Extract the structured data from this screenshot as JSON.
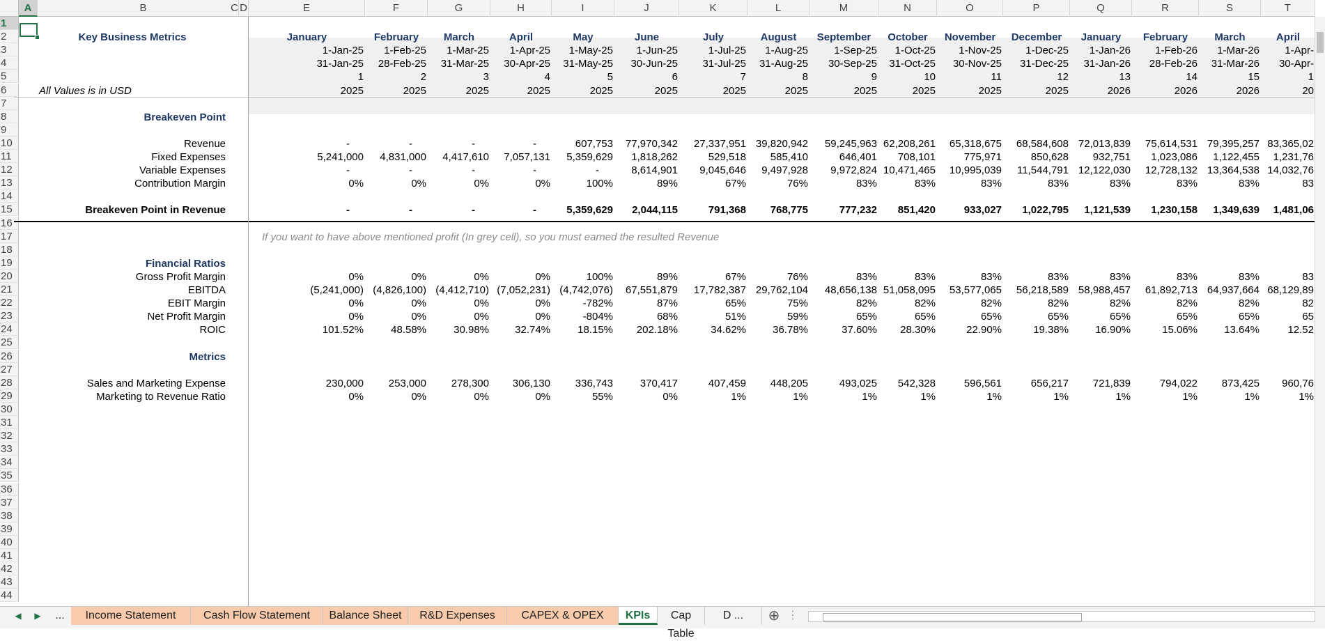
{
  "columns": [
    "A",
    "B",
    "C",
    "D",
    "E",
    "F",
    "G",
    "H",
    "I",
    "J",
    "K",
    "L",
    "M",
    "N",
    "O",
    "P",
    "Q",
    "R",
    "S",
    "T"
  ],
  "rows": [
    "1",
    "2",
    "3",
    "4",
    "5",
    "6",
    "7",
    "8",
    "9",
    "10",
    "11",
    "12",
    "13",
    "14",
    "15",
    "16",
    "17",
    "18",
    "19",
    "20",
    "21",
    "22",
    "23",
    "24",
    "25",
    "26",
    "27",
    "28",
    "29",
    "30",
    "31",
    "32",
    "33",
    "34",
    "35",
    "36",
    "37",
    "38",
    "39",
    "40",
    "41",
    "42",
    "43",
    "44"
  ],
  "header": {
    "title": "Key Business Metrics",
    "units_note": "All Values is in USD",
    "months": [
      "January",
      "February",
      "March",
      "April",
      "May",
      "June",
      "July",
      "August",
      "September",
      "October",
      "November",
      "December",
      "January",
      "February",
      "March",
      "April"
    ],
    "start_dates": [
      "1-Jan-25",
      "1-Feb-25",
      "1-Mar-25",
      "1-Apr-25",
      "1-May-25",
      "1-Jun-25",
      "1-Jul-25",
      "1-Aug-25",
      "1-Sep-25",
      "1-Oct-25",
      "1-Nov-25",
      "1-Dec-25",
      "1-Jan-26",
      "1-Feb-26",
      "1-Mar-26",
      "1-Apr-"
    ],
    "end_dates": [
      "31-Jan-25",
      "28-Feb-25",
      "31-Mar-25",
      "30-Apr-25",
      "31-May-25",
      "30-Jun-25",
      "31-Jul-25",
      "31-Aug-25",
      "30-Sep-25",
      "31-Oct-25",
      "30-Nov-25",
      "31-Dec-25",
      "31-Jan-26",
      "28-Feb-26",
      "31-Mar-26",
      "30-Apr-"
    ],
    "periods": [
      "1",
      "2",
      "3",
      "4",
      "5",
      "6",
      "7",
      "8",
      "9",
      "10",
      "11",
      "12",
      "13",
      "14",
      "15",
      "1"
    ],
    "years": [
      "2025",
      "2025",
      "2025",
      "2025",
      "2025",
      "2025",
      "2025",
      "2025",
      "2025",
      "2025",
      "2025",
      "2025",
      "2026",
      "2026",
      "2026",
      "20"
    ]
  },
  "sections": {
    "breakeven_title": "Breakeven Point",
    "ratios_title": "Financial Ratios",
    "metrics_title": "Metrics",
    "note": "If you want to have above mentioned profit (In grey cell), so you must earned the resulted Revenue"
  },
  "rows_data": [
    {
      "label": "Revenue",
      "row": 10,
      "values": [
        "-",
        "-",
        "-",
        "-",
        "607,753",
        "77,970,342",
        "27,337,951",
        "39,820,942",
        "59,245,963",
        "62,208,261",
        "65,318,675",
        "68,584,608",
        "72,013,839",
        "75,614,531",
        "79,395,257",
        "83,365,02"
      ]
    },
    {
      "label": "Fixed Expenses",
      "row": 11,
      "values": [
        "5,241,000",
        "4,831,000",
        "4,417,610",
        "7,057,131",
        "5,359,629",
        "1,818,262",
        "529,518",
        "585,410",
        "646,401",
        "708,101",
        "775,971",
        "850,628",
        "932,751",
        "1,023,086",
        "1,122,455",
        "1,231,76"
      ]
    },
    {
      "label": "Variable Expenses",
      "row": 12,
      "values": [
        "-",
        "-",
        "-",
        "-",
        "-",
        "8,614,901",
        "9,045,646",
        "9,497,928",
        "9,972,824",
        "10,471,465",
        "10,995,039",
        "11,544,791",
        "12,122,030",
        "12,728,132",
        "13,364,538",
        "14,032,76"
      ]
    },
    {
      "label": "Contribution Margin",
      "row": 13,
      "values": [
        "0%",
        "0%",
        "0%",
        "0%",
        "100%",
        "89%",
        "67%",
        "76%",
        "83%",
        "83%",
        "83%",
        "83%",
        "83%",
        "83%",
        "83%",
        "83"
      ]
    },
    {
      "label": "Breakeven Point in Revenue",
      "row": 15,
      "bold": true,
      "values": [
        "-",
        "-",
        "-",
        "-",
        "5,359,629",
        "2,044,115",
        "791,368",
        "768,775",
        "777,232",
        "851,420",
        "933,027",
        "1,022,795",
        "1,121,539",
        "1,230,158",
        "1,349,639",
        "1,481,06"
      ]
    },
    {
      "label": "Gross Profit Margin",
      "row": 20,
      "values": [
        "0%",
        "0%",
        "0%",
        "0%",
        "100%",
        "89%",
        "67%",
        "76%",
        "83%",
        "83%",
        "83%",
        "83%",
        "83%",
        "83%",
        "83%",
        "83"
      ]
    },
    {
      "label": "EBITDA",
      "row": 21,
      "values": [
        "(5,241,000)",
        "(4,826,100)",
        "(4,412,710)",
        "(7,052,231)",
        "(4,742,076)",
        "67,551,879",
        "17,782,387",
        "29,762,104",
        "48,656,138",
        "51,058,095",
        "53,577,065",
        "56,218,589",
        "58,988,457",
        "61,892,713",
        "64,937,664",
        "68,129,89"
      ]
    },
    {
      "label": "EBIT Margin",
      "row": 22,
      "values": [
        "0%",
        "0%",
        "0%",
        "0%",
        "-782%",
        "87%",
        "65%",
        "75%",
        "82%",
        "82%",
        "82%",
        "82%",
        "82%",
        "82%",
        "82%",
        "82"
      ]
    },
    {
      "label": "Net Profit Margin",
      "row": 23,
      "values": [
        "0%",
        "0%",
        "0%",
        "0%",
        "-804%",
        "68%",
        "51%",
        "59%",
        "65%",
        "65%",
        "65%",
        "65%",
        "65%",
        "65%",
        "65%",
        "65"
      ]
    },
    {
      "label": "ROIC",
      "row": 24,
      "values": [
        "101.52%",
        "48.58%",
        "30.98%",
        "32.74%",
        "18.15%",
        "202.18%",
        "34.62%",
        "36.78%",
        "37.60%",
        "28.30%",
        "22.90%",
        "19.38%",
        "16.90%",
        "15.06%",
        "13.64%",
        "12.52"
      ]
    },
    {
      "label": "Sales and Marketing Expense",
      "row": 28,
      "values": [
        "230,000",
        "253,000",
        "278,300",
        "306,130",
        "336,743",
        "370,417",
        "407,459",
        "448,205",
        "493,025",
        "542,328",
        "596,561",
        "656,217",
        "721,839",
        "794,022",
        "873,425",
        "960,76"
      ]
    },
    {
      "label": "Marketing to Revenue Ratio",
      "row": 29,
      "values": [
        "0%",
        "0%",
        "0%",
        "0%",
        "55%",
        "0%",
        "1%",
        "1%",
        "1%",
        "1%",
        "1%",
        "1%",
        "1%",
        "1%",
        "1%",
        "1%"
      ]
    }
  ],
  "tabs": {
    "more": "...",
    "items": [
      "Income Statement",
      "Cash Flow Statement",
      "Balance Sheet",
      "R&D Expenses",
      "CAPEX & OPEX",
      "KPIs",
      "Cap Table",
      "D ..."
    ],
    "active": "KPIs",
    "add_icon": "plus-circle-icon",
    "nav_prev_icon": "chevron-left-icon",
    "nav_next_icon": "chevron-right-icon"
  },
  "colors": {
    "accent": "#217346",
    "navy": "#1f3864",
    "tab_peach": "#f8cbad",
    "header_band": "#f0f0f0"
  }
}
